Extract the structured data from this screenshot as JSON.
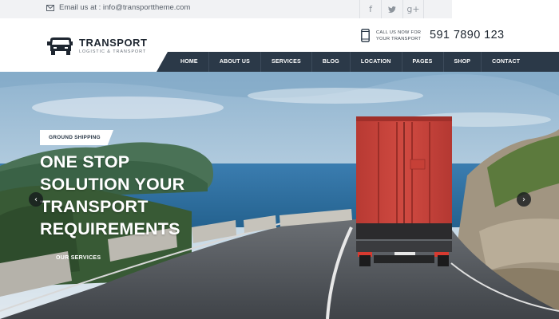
{
  "topbar": {
    "email_text": "Email us at : info@transporttheme.com",
    "social_icons": [
      "facebook-icon",
      "twitter-icon",
      "google-plus-icon"
    ]
  },
  "brand": {
    "name": "TRANSPORT",
    "tagline": "LOGISTIC & TRANSPORT"
  },
  "callus": {
    "line1": "CALL US NOW FOR",
    "line2": "YOUR TRANSPORT",
    "phone": "591 7890 123"
  },
  "nav": {
    "items": [
      {
        "label": "HOME"
      },
      {
        "label": "ABOUT US"
      },
      {
        "label": "SERVICES"
      },
      {
        "label": "BLOG"
      },
      {
        "label": "LOCATION"
      },
      {
        "label": "PAGES"
      },
      {
        "label": "SHOP"
      },
      {
        "label": "CONTACT"
      }
    ]
  },
  "hero": {
    "badge": "GROUND SHIPPING",
    "headline": [
      "ONE STOP",
      "SOLUTION YOUR",
      "TRANSPORT",
      "REQUIREMENTS"
    ],
    "link": "OUR SERVICES"
  },
  "colors": {
    "nav_bg": "#2b3948",
    "topbar_bg": "#f1f2f4",
    "container_red": "#c9443c",
    "sea": "#2d6e9e"
  }
}
